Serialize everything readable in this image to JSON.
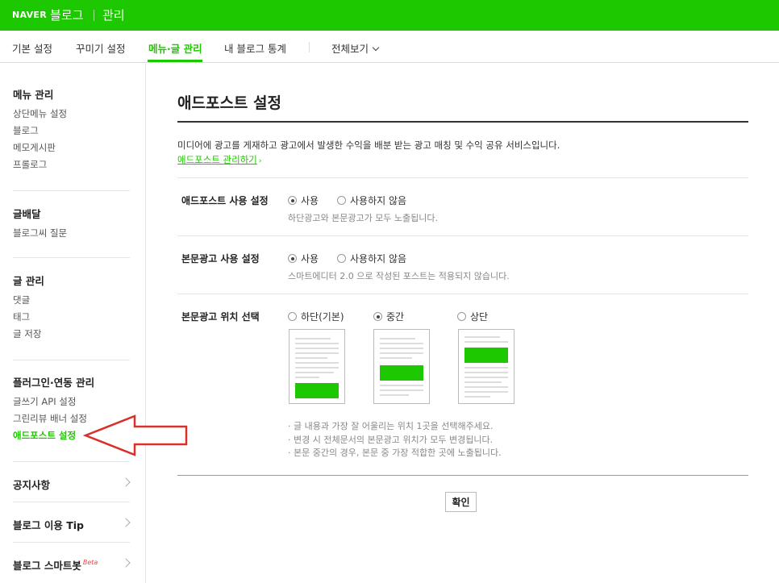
{
  "header": {
    "brand": "NAVER",
    "service": "블로그",
    "section": "관리"
  },
  "tabs": [
    {
      "label": "기본 설정"
    },
    {
      "label": "꾸미기 설정"
    },
    {
      "label": "메뉴·글 관리"
    },
    {
      "label": "내 블로그 통계"
    },
    {
      "label": "전체보기"
    }
  ],
  "sidebar": {
    "groups": [
      {
        "title": "메뉴 관리",
        "items": [
          "상단메뉴 설정",
          "블로그",
          "메모게시판",
          "프롤로그"
        ]
      },
      {
        "title": "글배달",
        "items": [
          "블로그씨 질문"
        ]
      },
      {
        "title": "글 관리",
        "items": [
          "댓글",
          "태그",
          "글 저장"
        ]
      },
      {
        "title": "플러그인·연동 관리",
        "items": [
          "글쓰기 API 설정",
          "그린리뷰 배너 설정",
          "애드포스트 설정"
        ]
      }
    ],
    "links": [
      {
        "label": "공지사항"
      },
      {
        "label": "블로그 이용 Tip"
      },
      {
        "label": "블로그 스마트봇",
        "badge": "Beta"
      }
    ]
  },
  "main": {
    "title": "애드포스트 설정",
    "description": "미디어에 광고를 게재하고 광고에서 발생한 수익을 배분 받는 광고 매칭 및 수익 공유 서비스입니다.",
    "manage_link": "애드포스트 관리하기",
    "rows": [
      {
        "label": "애드포스트 사용 설정",
        "options": [
          "사용",
          "사용하지 않음"
        ],
        "selected": "사용",
        "hint": "하단광고와 본문광고가 모두 노출됩니다."
      },
      {
        "label": "본문광고 사용 설정",
        "options": [
          "사용",
          "사용하지 않음"
        ],
        "selected": "사용",
        "hint": "스마트에디터 2.0 으로 작성된 포스트는 적용되지 않습니다."
      },
      {
        "label": "본문광고 위치 선택",
        "options": [
          "하단(기본)",
          "중간",
          "상단"
        ],
        "selected": "중간"
      }
    ],
    "notes": [
      "· 글 내용과 가장 잘 어울리는 위치 1곳을 선택해주세요.",
      "· 변경 시 전체문서의 본문광고 위치가 모두 변경됩니다.",
      "· 본문 중간의 경우, 본문 중 가장 적합한 곳에 노출됩니다."
    ],
    "confirm_label": "확인"
  },
  "colors": {
    "brand_green": "#1ec800",
    "annotation_arrow": "#d9302c"
  }
}
